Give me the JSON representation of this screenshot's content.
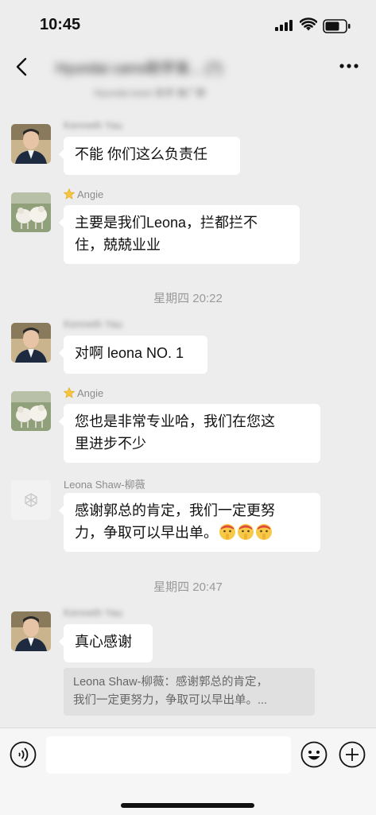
{
  "status_bar": {
    "time": "10:45"
  },
  "header": {
    "title": "Hyundai cams助学准... (7)",
    "subtitle": "Hyundai team 助学 推广群"
  },
  "messages": [
    {
      "sender": "Kenneth Yau",
      "sender_blurred": true,
      "avatar": "man-photo",
      "text": "不能 你们这么负责任"
    },
    {
      "sender": "Angie",
      "sender_star": true,
      "avatar": "sheep-photo",
      "text_lines": [
        "主要是我们Leona，拦都拦不",
        "住，兢兢业业"
      ]
    },
    {
      "timestamp": "星期四 20:22"
    },
    {
      "sender": "Kenneth Yau",
      "sender_blurred": true,
      "avatar": "man-photo",
      "text": "对啊 leona NO. 1"
    },
    {
      "sender": "Angie",
      "sender_star": true,
      "avatar": "sheep-photo",
      "text_lines": [
        "您也是非常专业哈，我们在您这",
        "里进步不少"
      ]
    },
    {
      "sender": "Leona Shaw-柳薇",
      "avatar": "logo-avatar",
      "text_lines": [
        "感谢郭总的肯定，我们一定更努",
        "力，争取可以早出单。"
      ],
      "emojis": [
        "shush-emoji",
        "shush-emoji",
        "shush-emoji"
      ]
    },
    {
      "timestamp": "星期四 20:47"
    },
    {
      "sender": "Kenneth Yau",
      "sender_blurred": true,
      "avatar": "man-photo",
      "text": "真心感谢",
      "quote_lines": [
        "Leona Shaw-柳薇：感谢郭总的肯定，",
        "我们一定更努力，争取可以早出单。..."
      ]
    }
  ],
  "input_bar": {
    "voice_icon": "voice-icon",
    "emoji_icon": "smiley-icon",
    "plus_icon": "plus-icon",
    "placeholder": ""
  }
}
